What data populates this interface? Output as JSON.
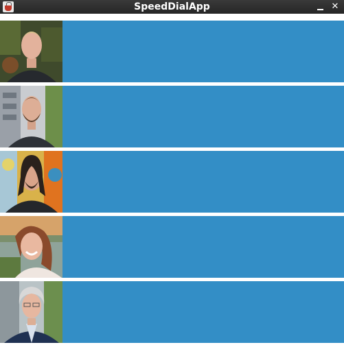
{
  "window": {
    "title": "SpeedDialApp",
    "minimize_glyph": "",
    "close_glyph": "✕"
  },
  "contacts": [
    {
      "icon": "contact-photo",
      "button_label": ""
    },
    {
      "icon": "contact-photo",
      "button_label": ""
    },
    {
      "icon": "contact-photo",
      "button_label": ""
    },
    {
      "icon": "contact-photo",
      "button_label": ""
    },
    {
      "icon": "contact-photo",
      "button_label": ""
    }
  ],
  "colors": {
    "dial_button": "#338ec6",
    "titlebar": "#2b2b2b",
    "background": "#ffffff"
  }
}
